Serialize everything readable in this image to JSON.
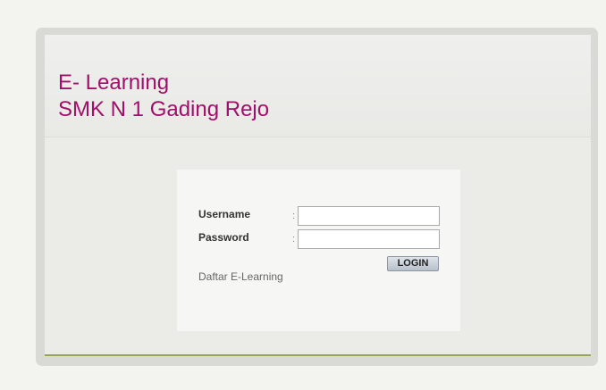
{
  "header": {
    "title_line1": "E- Learning",
    "title_line2": "SMK N 1 Gading Rejo"
  },
  "login_form": {
    "username_label": "Username",
    "password_label": "Password",
    "separator": ":",
    "username_value": "",
    "password_value": "",
    "login_button": "LOGIN",
    "register_link": "Daftar E-Learning"
  },
  "colors": {
    "title": "#a0106a",
    "panel": "#ececea",
    "frame": "#d9d9d6",
    "accent_line": "#9aa35c"
  }
}
